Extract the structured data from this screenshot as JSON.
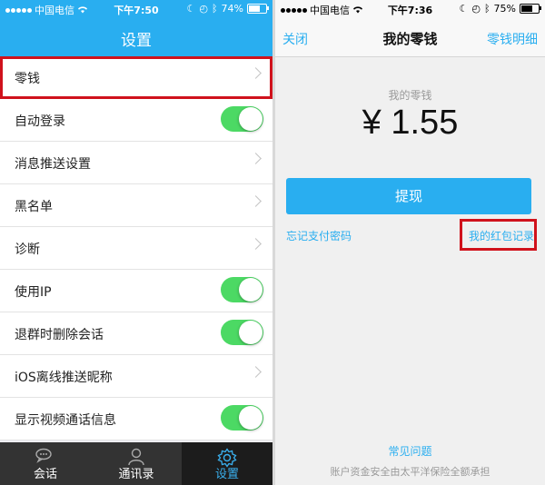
{
  "left": {
    "status": {
      "carrier": "中国电信",
      "time": "下午7:50",
      "battery": "74%",
      "battery_level": 0.74
    },
    "title": "设置",
    "rows": [
      {
        "label": "零钱",
        "kind": "chevron",
        "highlighted": true
      },
      {
        "label": "自动登录",
        "kind": "toggle",
        "on": true
      },
      {
        "label": "消息推送设置",
        "kind": "chevron"
      },
      {
        "label": "黑名单",
        "kind": "chevron"
      },
      {
        "label": "诊断",
        "kind": "chevron"
      },
      {
        "label": "使用IP",
        "kind": "toggle",
        "on": true
      },
      {
        "label": "退群时删除会话",
        "kind": "toggle",
        "on": true
      },
      {
        "label": "iOS离线推送昵称",
        "kind": "chevron"
      },
      {
        "label": "显示视频通话信息",
        "kind": "toggle",
        "on": true
      }
    ],
    "tabs": [
      {
        "label": "会话",
        "icon": "chat-bubbles-icon"
      },
      {
        "label": "通讯录",
        "icon": "person-icon"
      },
      {
        "label": "设置",
        "icon": "gear-icon",
        "active": true
      }
    ]
  },
  "right": {
    "status": {
      "carrier": "中国电信",
      "time": "下午7:36",
      "battery": "75%",
      "battery_level": 0.75
    },
    "nav": {
      "back": "关闭",
      "title": "我的零钱",
      "detail": "零钱明细"
    },
    "balance_label": "我的零钱",
    "balance": "¥ 1.55",
    "withdraw_button": "提现",
    "forgot_password": "忘记支付密码",
    "red_packet_records": "我的红包记录",
    "faq": "常见问题",
    "footer": "账户资金安全由太平洋保险全额承担"
  },
  "colors": {
    "accent": "#29aef0",
    "toggle_on": "#4cd964",
    "highlight": "#d0121c",
    "tabbar": "#333333"
  }
}
